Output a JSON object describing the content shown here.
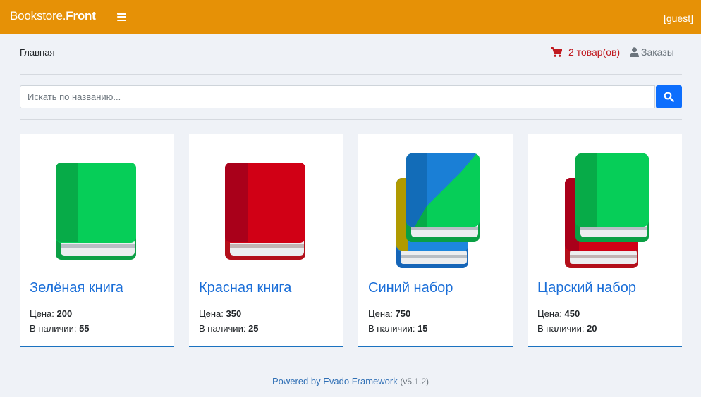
{
  "navbar": {
    "brand_prefix": "Bookstore.",
    "brand_bold": "Front",
    "user": "[guest]"
  },
  "breadcrumb": "Главная",
  "cart": {
    "label": "2 товар(ов)",
    "color": "#c0191f"
  },
  "orders": {
    "label": "Заказы"
  },
  "search": {
    "placeholder": "Искать по названию...",
    "value": ""
  },
  "colors": {
    "navbar": "#e69106",
    "accent": "#0d6efd",
    "title": "#1a6ed8"
  },
  "products": [
    {
      "title": "Зелёная книга",
      "price_label": "Цена:",
      "price": "200",
      "stock_label": "В наличии:",
      "stock": "55",
      "icon": "green-book-icon"
    },
    {
      "title": "Красная книга",
      "price_label": "Цена:",
      "price": "350",
      "stock_label": "В наличии:",
      "stock": "25",
      "icon": "red-book-icon"
    },
    {
      "title": "Синий набор",
      "price_label": "Цена:",
      "price": "750",
      "stock_label": "В наличии:",
      "stock": "15",
      "icon": "blue-books-set-icon"
    },
    {
      "title": "Царский набор",
      "price_label": "Цена:",
      "price": "450",
      "stock_label": "В наличии:",
      "stock": "20",
      "icon": "royal-books-set-icon"
    }
  ],
  "footer": {
    "link": "Powered by Evado Framework",
    "version": "(v5.1.2)"
  }
}
